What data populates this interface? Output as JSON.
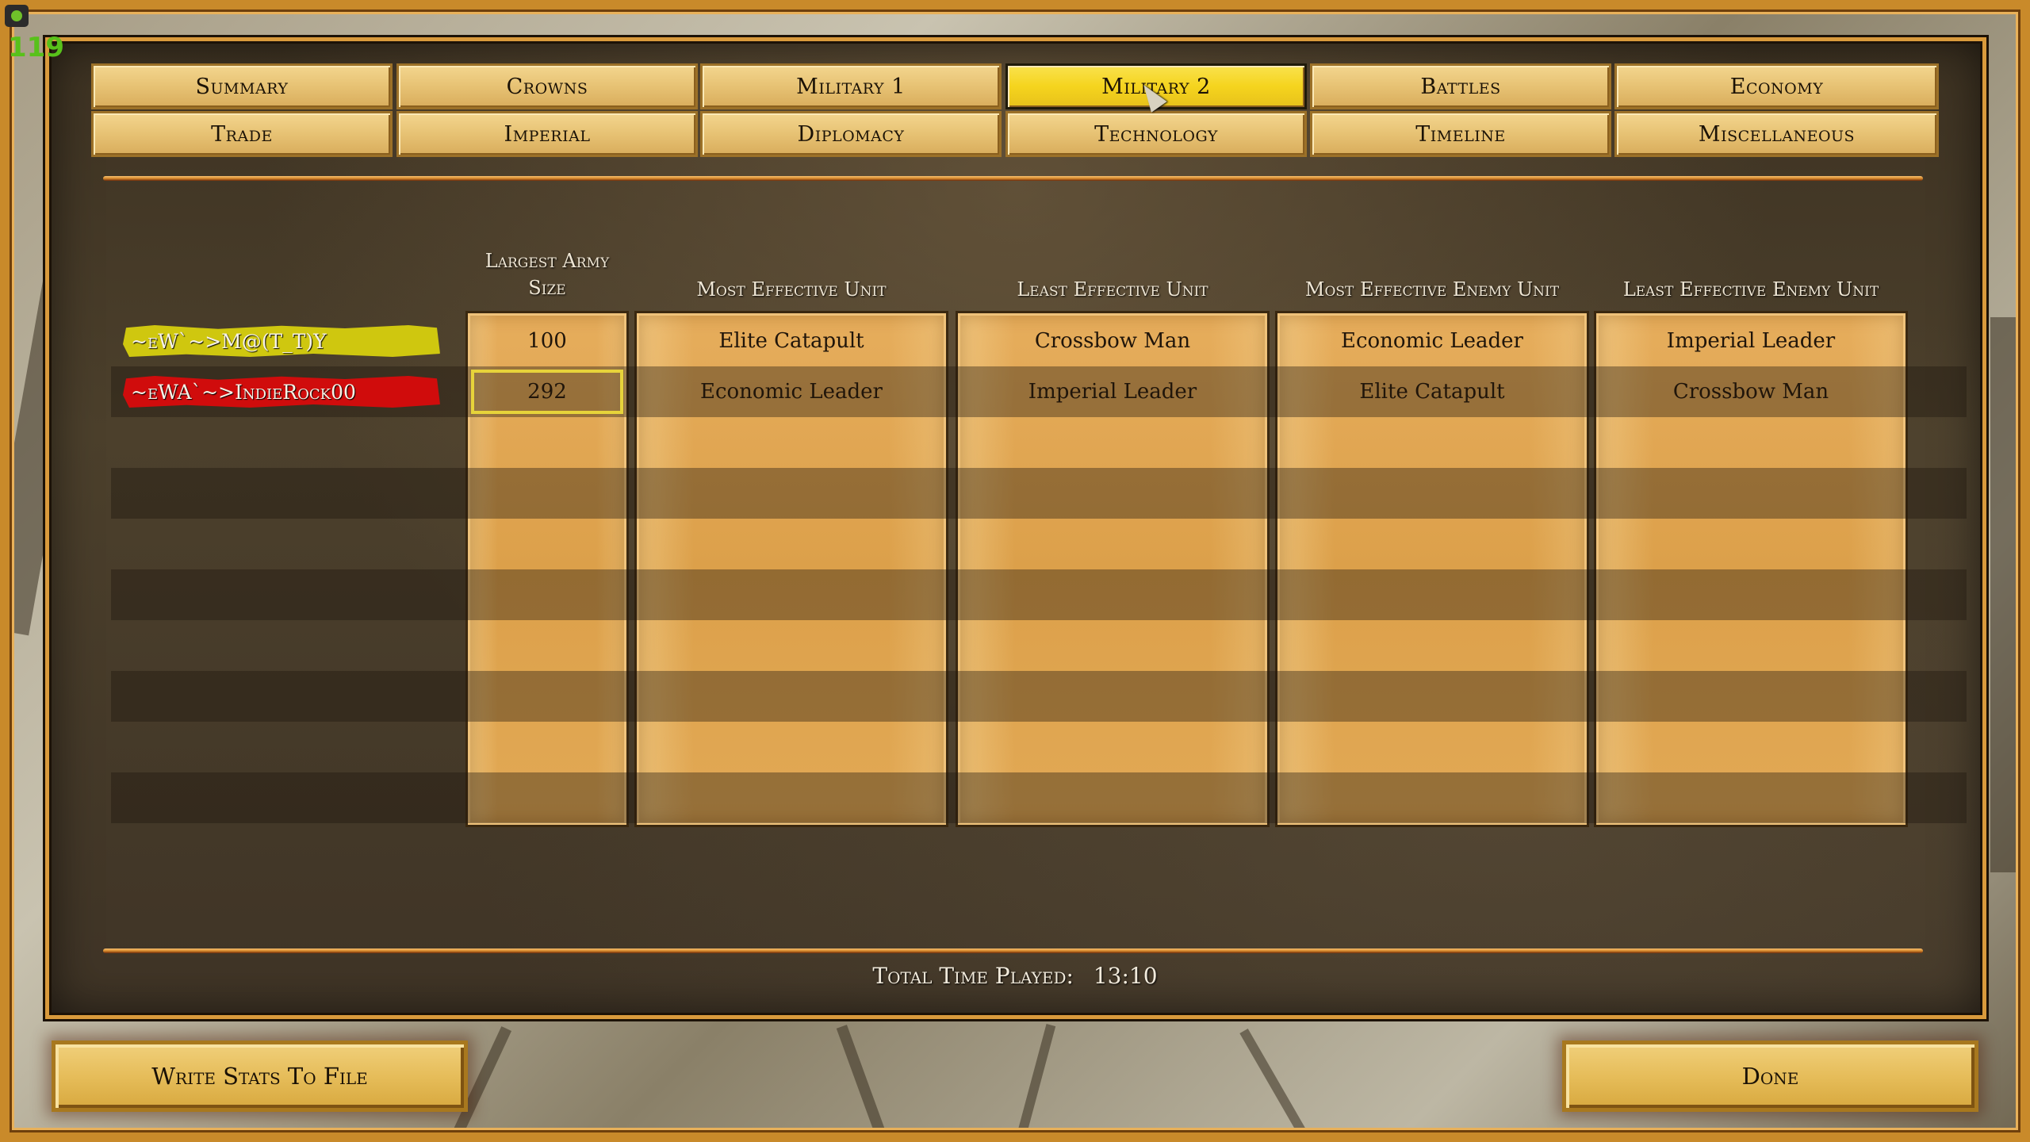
{
  "overlay": {
    "fps": "119"
  },
  "tabs": [
    {
      "label": "Summary",
      "active": false
    },
    {
      "label": "Crowns",
      "active": false
    },
    {
      "label": "Military 1",
      "active": false
    },
    {
      "label": "Military 2",
      "active": true
    },
    {
      "label": "Battles",
      "active": false
    },
    {
      "label": "Economy",
      "active": false
    },
    {
      "label": "Trade",
      "active": false
    },
    {
      "label": "Imperial",
      "active": false
    },
    {
      "label": "Diplomacy",
      "active": false
    },
    {
      "label": "Technology",
      "active": false
    },
    {
      "label": "Timeline",
      "active": false
    },
    {
      "label": "Miscellaneous",
      "active": false
    }
  ],
  "table": {
    "headers": {
      "largest_army_1": "Largest Army",
      "largest_army_2": "Size",
      "most_effective": "Most Effective Unit",
      "least_effective": "Least Effective Unit",
      "most_effective_enemy": "Most Effective Enemy Unit",
      "least_effective_enemy": "Least Effective Enemy Unit"
    },
    "players": [
      {
        "name": "~eW`~>M@(T_T)Y",
        "color": "#cfc70f",
        "army_size": "100",
        "most_effective": "Elite Catapult",
        "least_effective": "Crossbow Man",
        "most_effective_enemy": "Economic Leader",
        "least_effective_enemy": "Imperial Leader"
      },
      {
        "name": "~eWA`~>IndieRock00",
        "color": "#d00c0c",
        "army_size": "292",
        "most_effective": "Economic Leader",
        "least_effective": "Imperial Leader",
        "most_effective_enemy": "Elite Catapult",
        "least_effective_enemy": "Crossbow Man"
      }
    ]
  },
  "footer": {
    "total_time_label": "Total Time Played:",
    "total_time_value": "13:10",
    "write_stats_label": "Write Stats To File",
    "done_label": "Done"
  }
}
